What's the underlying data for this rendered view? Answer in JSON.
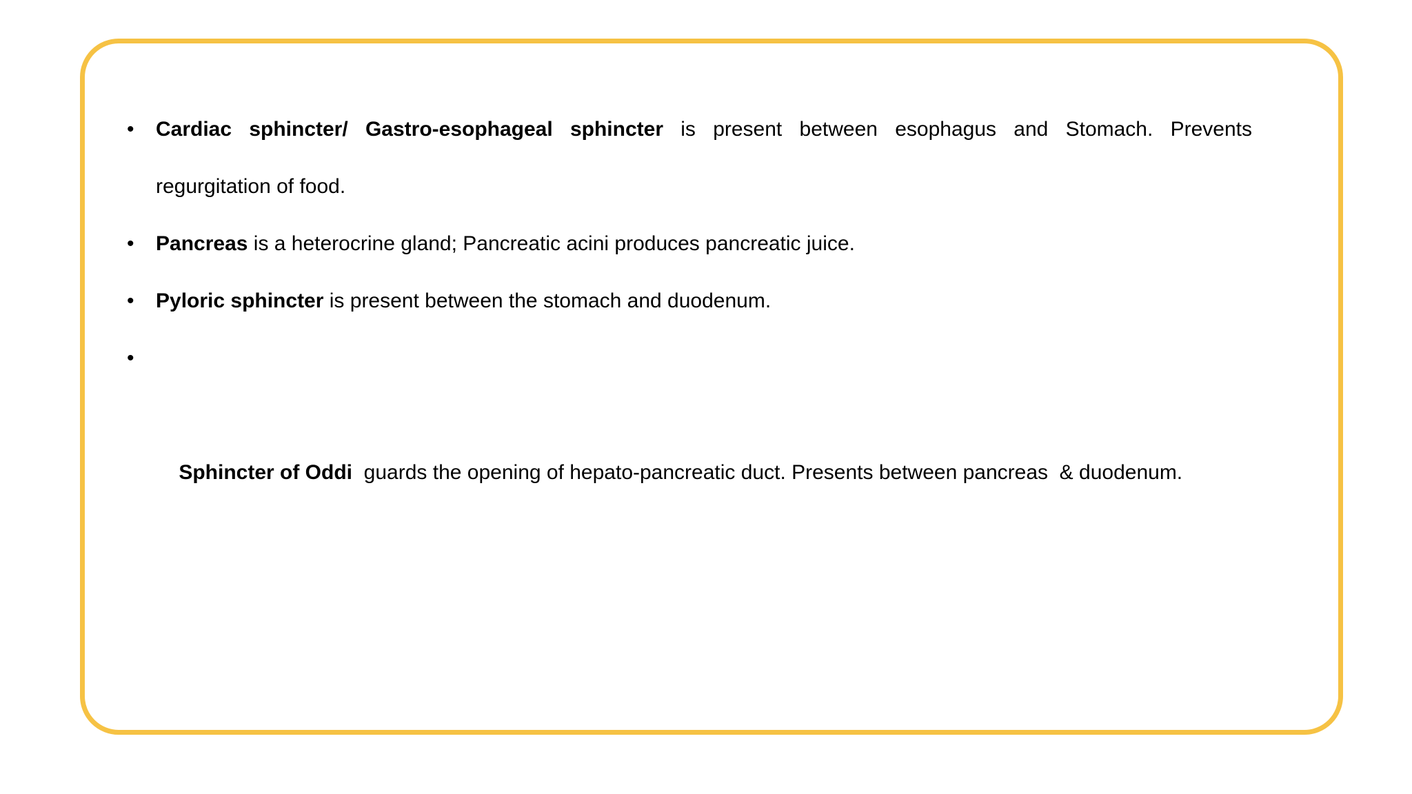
{
  "colors": {
    "frame_border": "#f6c244",
    "background": "#ffffff",
    "text": "#000000"
  },
  "bullets": [
    {
      "bold": "Cardiac sphincter/ Gastro-esophageal sphincter",
      "text": " is present between esophagus and Stomach. Prevents regurgitation of food."
    },
    {
      "bold": "Pancreas",
      "text": " is a heterocrine gland; Pancreatic acini produces pancreatic juice."
    },
    {
      "bold": "Pyloric sphincter",
      "text": " is present between the stomach and duodenum."
    },
    {
      "bold": "Sphincter of Oddi",
      "text": "  guards the opening of hepato-pancreatic duct. Presents between pancreas  & duodenum."
    }
  ]
}
